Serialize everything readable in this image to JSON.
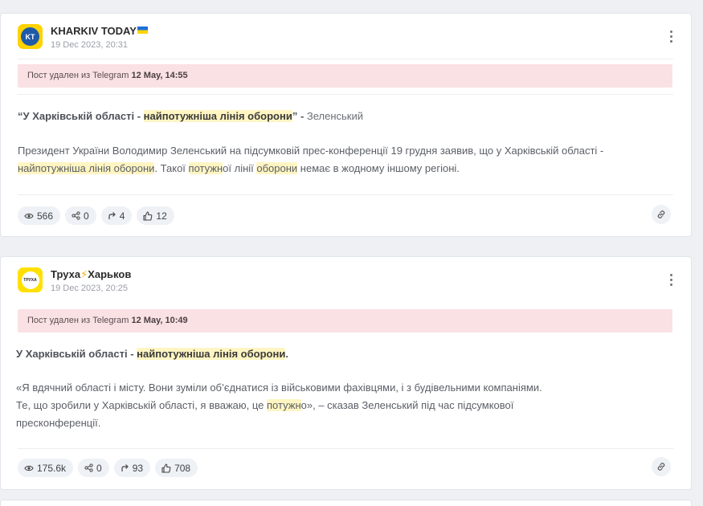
{
  "posts": [
    {
      "channel": "KHARKIV TODAY",
      "avatar_text": "KT",
      "date": "19 Dec 2023, 20:31",
      "deleted_prefix": "Пост удален из Telegram",
      "deleted_time": "12 May, 14:55",
      "title_parts": [
        "“У Харківській області - ",
        "найпотужніша лінія оборони",
        "” - ",
        "Зеленський"
      ],
      "body_parts": [
        "Президент України Володимир Зеленський на підсумковій прес-конференції 19 грудня заявив, що у Харківській області - ",
        "найпотужніша лінія оборони",
        ". Такої ",
        "потужн",
        "ої лінії ",
        "оборони",
        " немає в жодному іншому регіоні."
      ],
      "stats": {
        "views": "566",
        "shares": "0",
        "forwards": "4",
        "likes": "12"
      }
    },
    {
      "channel": "Труха",
      "channel_suffix": "Харьков",
      "avatar_text": "ТРУХА",
      "date": "19 Dec 2023, 20:25",
      "deleted_prefix": "Пост удален из Telegram",
      "deleted_time": "12 May, 10:49",
      "title_parts": [
        "У Харківській області - ",
        "найпотужніша лінія оборони",
        "."
      ],
      "body_line1": "«Я вдячний області і місту. Вони зуміли об’єднатися із військовими фахівцями, і з будівельними компаніями.",
      "body_line2_parts": [
        "Те, що зробили у Харківській області, я вважаю, це ",
        "потужн",
        "о», – сказав Зеленський під час підсумкової"
      ],
      "body_line3": "пресконференції.",
      "stats": {
        "views": "175.6k",
        "shares": "0",
        "forwards": "93",
        "likes": "708"
      }
    }
  ],
  "colors": {
    "highlight": "#fff5c2",
    "deleted_bg": "#fae1e4",
    "pill_bg": "#eef1f5"
  }
}
